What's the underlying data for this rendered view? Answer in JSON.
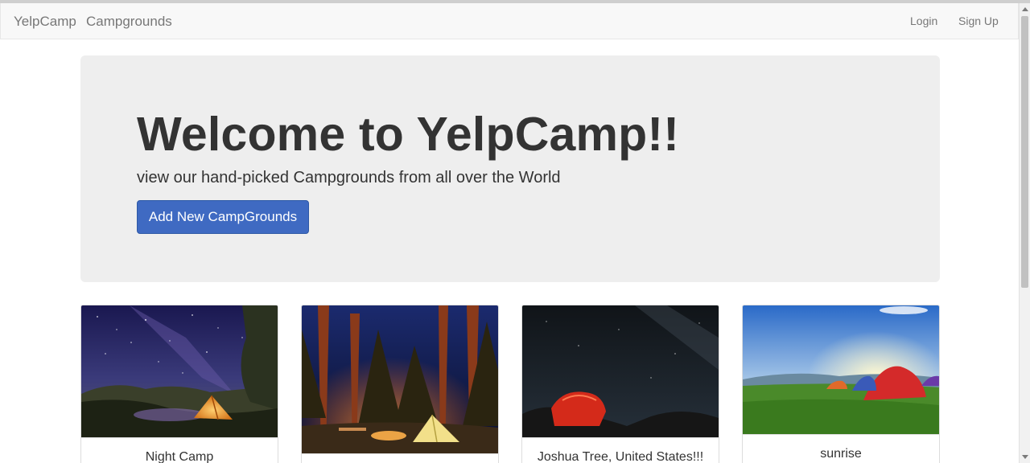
{
  "navbar": {
    "brand": "YelpCamp",
    "links": [
      "Campgrounds"
    ],
    "right_links": [
      "Login",
      "Sign Up"
    ]
  },
  "jumbotron": {
    "title": "Welcome to YelpCamp!!",
    "subtitle": "view our hand-picked Campgrounds from all over the World",
    "button_label": "Add New CampGrounds"
  },
  "campgrounds": [
    {
      "name": "Night Camp"
    },
    {
      "name": ""
    },
    {
      "name": "Joshua Tree, United States!!!"
    },
    {
      "name": "sunrise"
    }
  ],
  "colors": {
    "primary_button": "#3f6ac2",
    "navbar_bg": "#f8f8f8",
    "jumbotron_bg": "#eeeeee"
  }
}
